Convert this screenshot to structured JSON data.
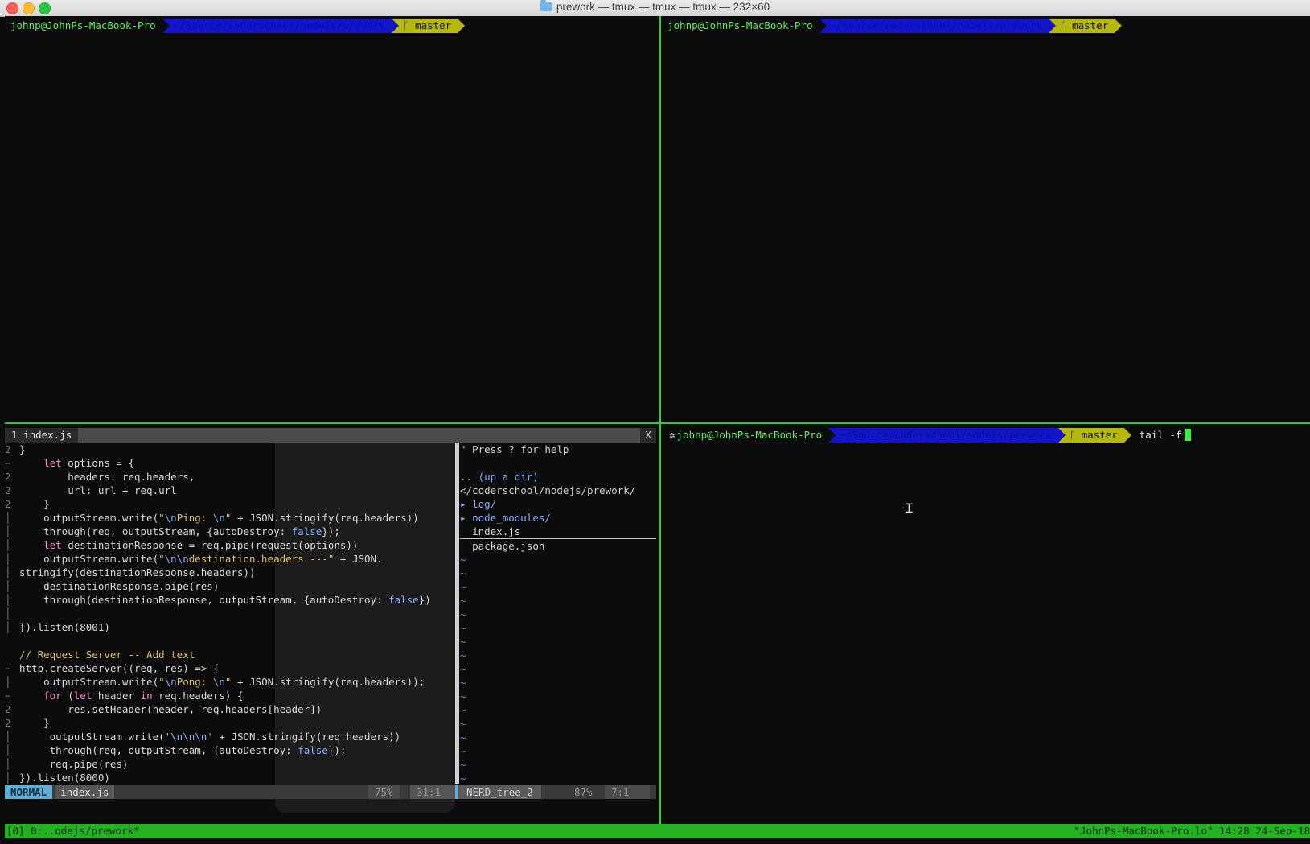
{
  "window": {
    "title": "prework — tmux — tmux — tmux — 232×60"
  },
  "prompt": {
    "user": "johnp@JohnPs-MacBook-Pro",
    "path": "~/Source/coderschool/nodejs/prework",
    "branch": "master"
  },
  "bottom_right_prompt": {
    "command": "tail -f"
  },
  "vim": {
    "tab": "1 index.js",
    "tab_close": "X",
    "code_lines": [
      {
        "g": "2",
        "t": "}"
      },
      {
        "g": "−",
        "t": "    let options = {"
      },
      {
        "g": "2",
        "t": "        headers: req.headers,"
      },
      {
        "g": "2",
        "t": "        url: url + req.url"
      },
      {
        "g": "2",
        "t": "    }"
      },
      {
        "g": "│",
        "t": "    outputStream.write(\"\\nPing: \\n\" + JSON.stringify(req.headers))"
      },
      {
        "g": "│",
        "t": "    through(req, outputStream, {autoDestroy: false});"
      },
      {
        "g": "│",
        "t": "    let destinationResponse = req.pipe(request(options))"
      },
      {
        "g": "│",
        "t": "    outputStream.write(\"\\n\\ndestination.headers ---\" + JSON."
      },
      {
        "g": "│",
        "t": "stringify(destinationResponse.headers))"
      },
      {
        "g": "│",
        "t": "    destinationResponse.pipe(res)"
      },
      {
        "g": "│",
        "t": "    through(destinationResponse, outputStream, {autoDestroy: false})"
      },
      {
        "g": "│",
        "t": ""
      },
      {
        "g": "│",
        "t": "}).listen(8001)"
      },
      {
        "g": "",
        "t": ""
      },
      {
        "g": "",
        "t": "// Request Server -- Add text"
      },
      {
        "g": "−",
        "t": "http.createServer((req, res) => {"
      },
      {
        "g": "│",
        "t": "    outputStream.write(\"\\nPong: \\n\" + JSON.stringify(req.headers));"
      },
      {
        "g": "−",
        "t": "    for (let header in req.headers) {"
      },
      {
        "g": "2",
        "t": "        res.setHeader(header, req.headers[header])"
      },
      {
        "g": "2",
        "t": "    }"
      },
      {
        "g": "│",
        "t": "     outputStream.write('\\n\\n\\n' + JSON.stringify(req.headers))"
      },
      {
        "g": "│",
        "t": "     through(req, outputStream, {autoDestroy: false});"
      },
      {
        "g": "│",
        "t": "     req.pipe(res)"
      },
      {
        "g": "│",
        "t": "}).listen(8000)"
      }
    ],
    "tree": {
      "help": "\" Press ? for help",
      "up": ".. (up a dir)",
      "root": "</coderschool/nodejs/prework/",
      "entries": [
        {
          "arrow": "▸",
          "name": "log/"
        },
        {
          "arrow": "▸",
          "name": "node_modules/"
        },
        {
          "arrow": "",
          "name": "index.js"
        },
        {
          "arrow": "",
          "name": "package.json"
        }
      ],
      "tilde": "~"
    },
    "status_left": {
      "mode": "NORMAL",
      "file": "index.js",
      "percent": "75%",
      "position": "31:1"
    },
    "status_right": {
      "name": "NERD_tree_2",
      "percent": "87%",
      "position": "7:1"
    }
  },
  "tmux": {
    "left": "[0] 0:..odejs/prework*",
    "right": "\"JohnPs-MacBook-Pro.lo\" 14:28 24-Sep-18"
  },
  "colors": {
    "pane_border": "#2fcf2f",
    "status_bar": "#22b222",
    "path_bg": "#1313c8",
    "branch_bg": "#b6b80c"
  }
}
